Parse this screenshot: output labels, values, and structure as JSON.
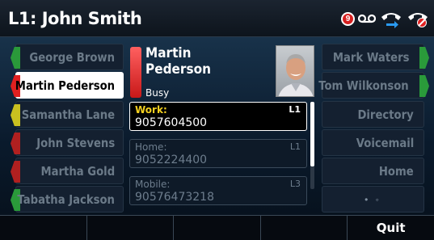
{
  "header": {
    "title": "L1: John Smith",
    "voicemail_count": "9",
    "icons": [
      "voicemail-icon",
      "call-forward-icon",
      "do-not-disturb-icon"
    ]
  },
  "left_keys": [
    {
      "label": "George Brown",
      "status_color": "#2a9a3a",
      "active": false
    },
    {
      "label": "Martin Pederson",
      "status_color": "#e02020",
      "active": true
    },
    {
      "label": "Samantha Lane",
      "status_color": "#c8c020",
      "active": false
    },
    {
      "label": "John Stevens",
      "status_color": "#b02020",
      "active": false
    },
    {
      "label": "Martha Gold",
      "status_color": "#b02020",
      "active": false
    },
    {
      "label": "Tabatha Jackson",
      "status_color": "#2a9a3a",
      "active": false
    }
  ],
  "right_keys": [
    {
      "label": "Mark Waters",
      "status_color": "#2a9a3a"
    },
    {
      "label": "Tom Wilkonson",
      "status_color": "#2a9a3a"
    },
    {
      "label": "Directory",
      "status_color": ""
    },
    {
      "label": "Voicemail",
      "status_color": ""
    },
    {
      "label": "Home",
      "status_color": ""
    },
    {
      "label": "• ◦",
      "status_color": ""
    }
  ],
  "contact": {
    "name": "Martin Pederson",
    "status": "Busy",
    "presence_color": "#e02020",
    "numbers": [
      {
        "type": "Work:",
        "number": "9057604500",
        "line": "L1",
        "selected": true
      },
      {
        "type": "Home:",
        "number": "9052224400",
        "line": "L1",
        "selected": false
      },
      {
        "type": "Mobile:",
        "number": "90576473218",
        "line": "L3",
        "selected": false
      }
    ]
  },
  "softkeys": [
    "",
    "",
    "",
    "",
    "Quit"
  ]
}
